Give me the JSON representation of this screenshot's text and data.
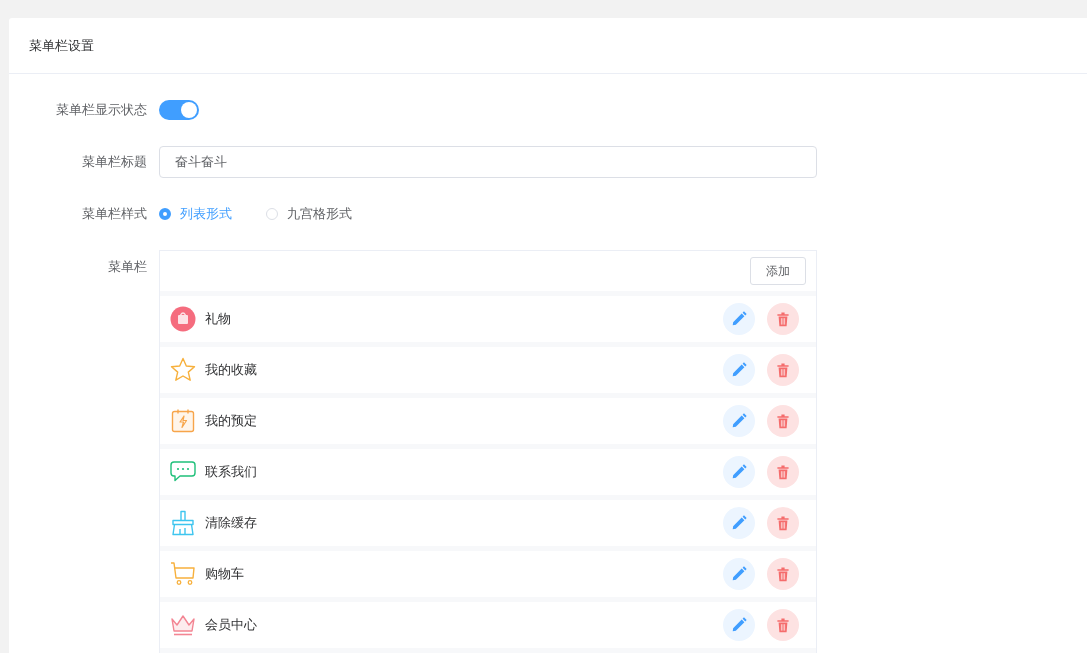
{
  "card": {
    "title": "菜单栏设置"
  },
  "form": {
    "visible_label": "菜单栏显示状态",
    "visible_on": true,
    "title_label": "菜单栏标题",
    "title_value": "奋斗奋斗",
    "style_label": "菜单栏样式",
    "style_options": [
      {
        "label": "列表形式",
        "selected": true
      },
      {
        "label": "九宫格形式",
        "selected": false
      }
    ],
    "menu_label": "菜单栏",
    "add_button": "添加",
    "items": [
      {
        "label": "礼物",
        "kind": "bag"
      },
      {
        "label": "我的收藏",
        "kind": "star"
      },
      {
        "label": "我的预定",
        "kind": "calendar"
      },
      {
        "label": "联系我们",
        "kind": "chat"
      },
      {
        "label": "清除缓存",
        "kind": "broom"
      },
      {
        "label": "购物车",
        "kind": "cart"
      },
      {
        "label": "会员中心",
        "kind": "crown"
      }
    ]
  }
}
